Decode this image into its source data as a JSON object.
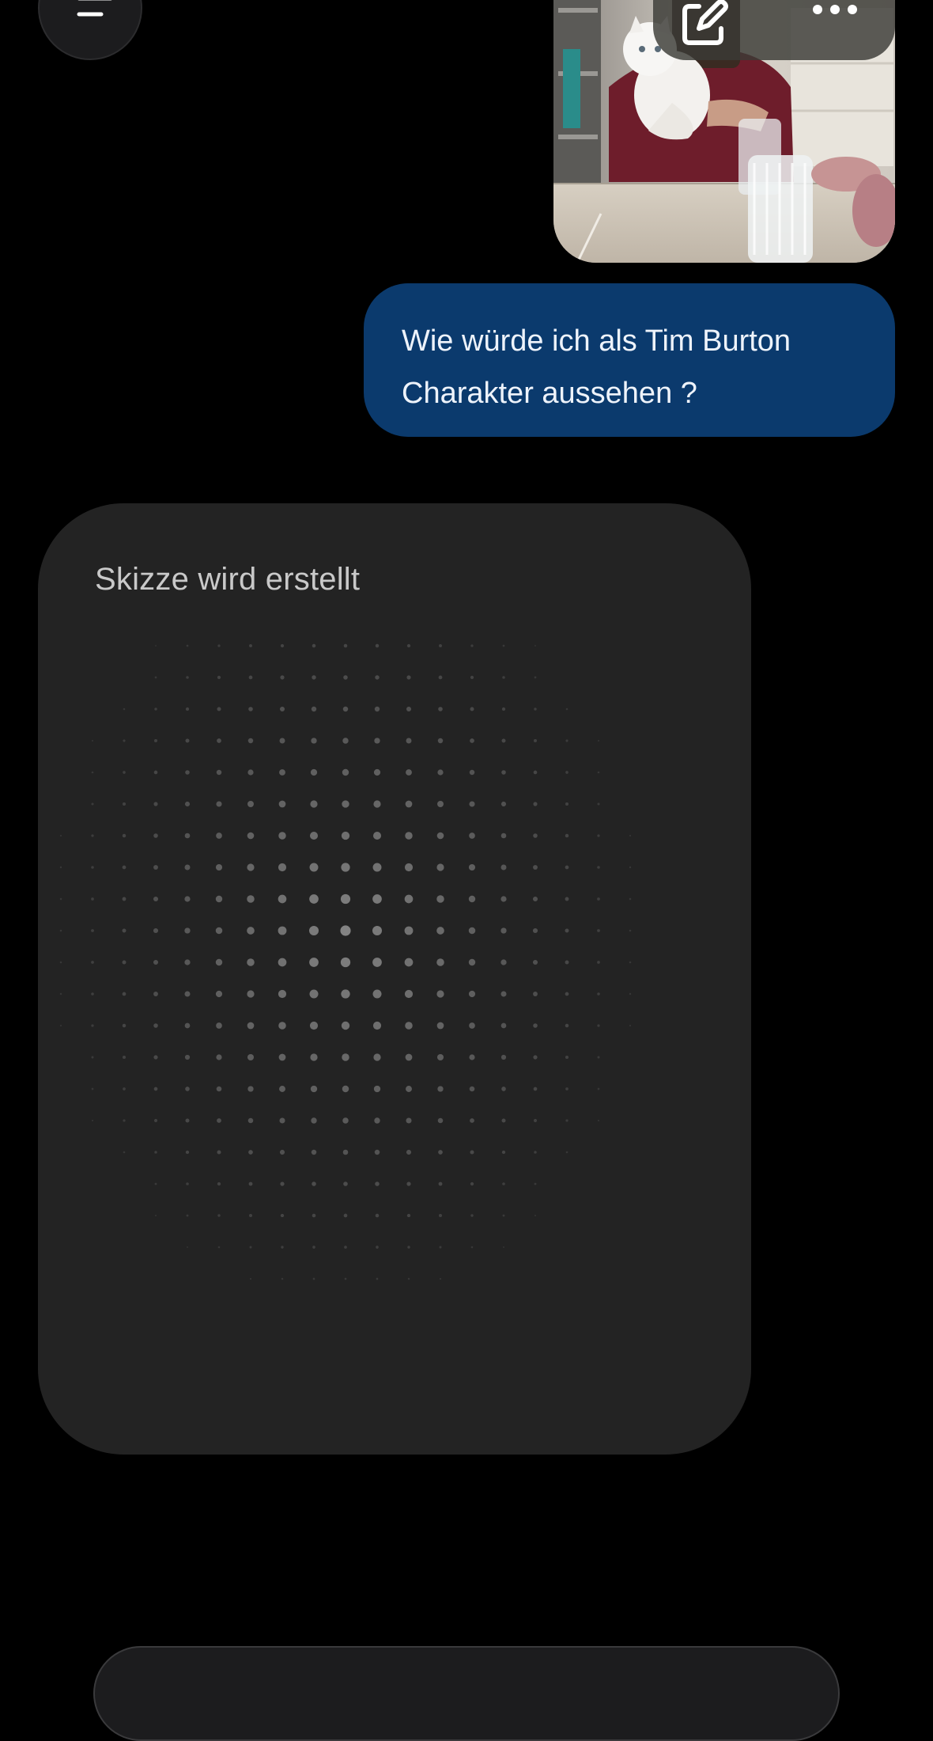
{
  "header": {
    "menu_icon": "menu-icon",
    "edit_icon": "edit-icon",
    "more_icon": "more-icon"
  },
  "conversation": {
    "user_image": {
      "subject": "photo"
    },
    "user_message": {
      "text": "Wie würde ich als Tim Burton Charakter aussehen ?"
    },
    "assistant": {
      "status_label": "Skizze wird erstellt"
    }
  },
  "colors": {
    "background": "#000000",
    "user_bubble": "#0b3a6d",
    "card": "#232323",
    "dots": "#8e8e8e"
  }
}
